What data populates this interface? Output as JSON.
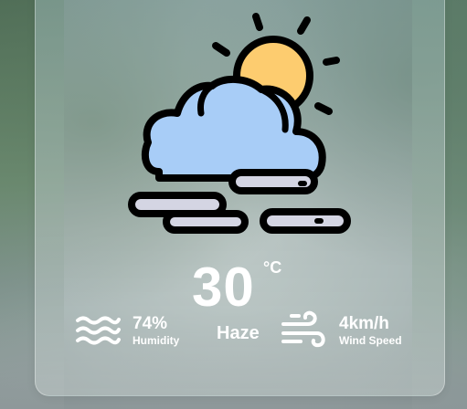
{
  "weather": {
    "icon": "partly-cloudy-haze-icon",
    "temperature": "30",
    "unit": "°C",
    "condition": "Haze"
  },
  "humidity": {
    "icon": "waves-icon",
    "value": "74%",
    "label": "Humidity"
  },
  "wind": {
    "icon": "wind-icon",
    "value": "4km/h",
    "label": "Wind Speed"
  },
  "colors": {
    "sun": "#fdcc6f",
    "cloud": "#a8cdf7",
    "mist": "#d4d5e3",
    "outline": "#000000",
    "text": "#ffffff"
  }
}
